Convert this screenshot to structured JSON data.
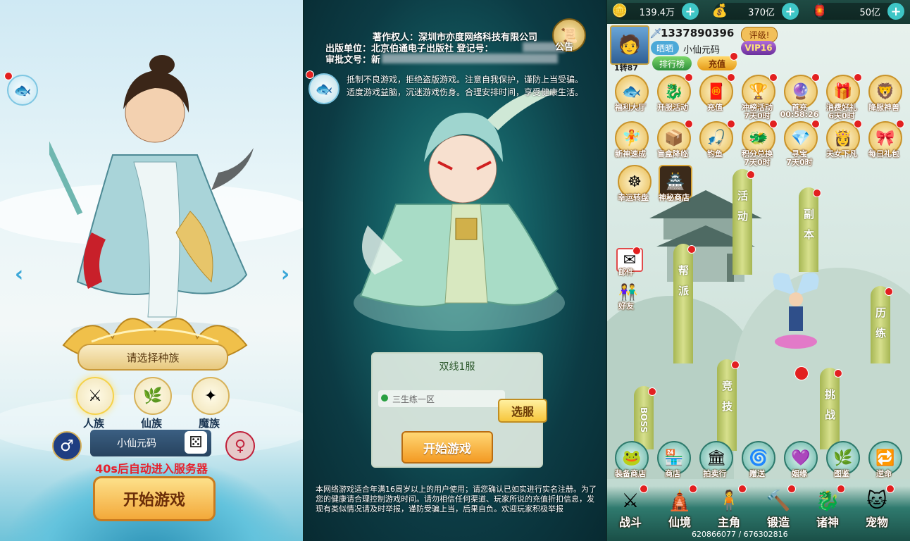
{
  "panel1": {
    "race_prompt": "请选择种族",
    "races": [
      {
        "label": "人族",
        "icon": "human-race-icon"
      },
      {
        "label": "仙族",
        "icon": "immortal-race-icon"
      },
      {
        "label": "魔族",
        "icon": "demon-race-icon"
      }
    ],
    "male_symbol": "♂",
    "female_symbol": "♀",
    "player_name": "小仙元码",
    "countdown_text": "40s后自动进入服务器",
    "start_label": "开始游戏",
    "dice_symbol": "⚄"
  },
  "panel2": {
    "copyright_owner": "著作权人：深圳市亦度网络科技有限公司",
    "publisher": "出版单位：北京伯通电子出版社 登记号：",
    "approval": "审批文号：新",
    "notice_btn": "公告",
    "anti_addiction": [
      "抵制不良游戏，拒绝盗版游戏。注意自我保护，谨防上当受骗。",
      "适度游戏益脑，沉迷游戏伤身。合理安排时间，享受健康生活。"
    ],
    "server_title": "双线1服",
    "server_row": "三生练一区",
    "select_server": "选服",
    "start_label": "开始游戏",
    "footer_notice": "本网络游戏适合年满16周岁以上的用户使用；请您确认已如实进行实名注册。为了您的健康请合理控制游戏时间。请勿相信任何渠道、玩家所说的充值折扣信息，发现有类似情况请及时举报，谨防受骗上当，后果自负。欢迎玩家积极举报"
  },
  "panel3": {
    "resources": [
      {
        "icon": "silver-icon",
        "value": "139.4万"
      },
      {
        "icon": "gold-ingot-icon",
        "value": "370亿"
      },
      {
        "icon": "yuanbao-icon",
        "value": "50亿"
      }
    ],
    "uid": "1337890396",
    "rank_tag": "评级!",
    "guild_tag": "晒晒",
    "name": "小仙元码",
    "vip": "VIP16",
    "level": "1转87",
    "leaderboard": "排行榜",
    "recharge": "充值",
    "row1": [
      {
        "label": "福利大厅",
        "sub": ""
      },
      {
        "label": "开服活动",
        "sub": ""
      },
      {
        "label": "充值",
        "sub": ""
      },
      {
        "label": "冲榜活动",
        "sub": "7天0时"
      },
      {
        "label": "首充",
        "sub": "00:58:26"
      },
      {
        "label": "消费好礼",
        "sub": "6天0时"
      },
      {
        "label": "降服神兽",
        "sub": ""
      }
    ],
    "row2": [
      {
        "label": "新神速成",
        "sub": ""
      },
      {
        "label": "盲盒降临",
        "sub": ""
      },
      {
        "label": "钓鱼",
        "sub": ""
      },
      {
        "label": "积分兑换",
        "sub": "7天0时"
      },
      {
        "label": "寻宝",
        "sub": "7天0时"
      },
      {
        "label": "天女下凡",
        "sub": ""
      },
      {
        "label": "每日礼包",
        "sub": ""
      }
    ],
    "lucky_spin": "幸运转盘",
    "mystery_shop": "神秘商店",
    "mail": "邮件",
    "friends": "好友",
    "pillars": [
      "活动",
      "副本",
      "帮派",
      "历练",
      "竞技",
      "挑战",
      "BOSS"
    ],
    "function_row": [
      "装备商店",
      "商店",
      "拍卖行",
      "赠送",
      "姻缘",
      "图鉴",
      "逆命"
    ],
    "nav": [
      "战斗",
      "仙境",
      "主角",
      "锻造",
      "诸神",
      "宠物"
    ],
    "footer_ids": "620866077 / 676302816"
  }
}
